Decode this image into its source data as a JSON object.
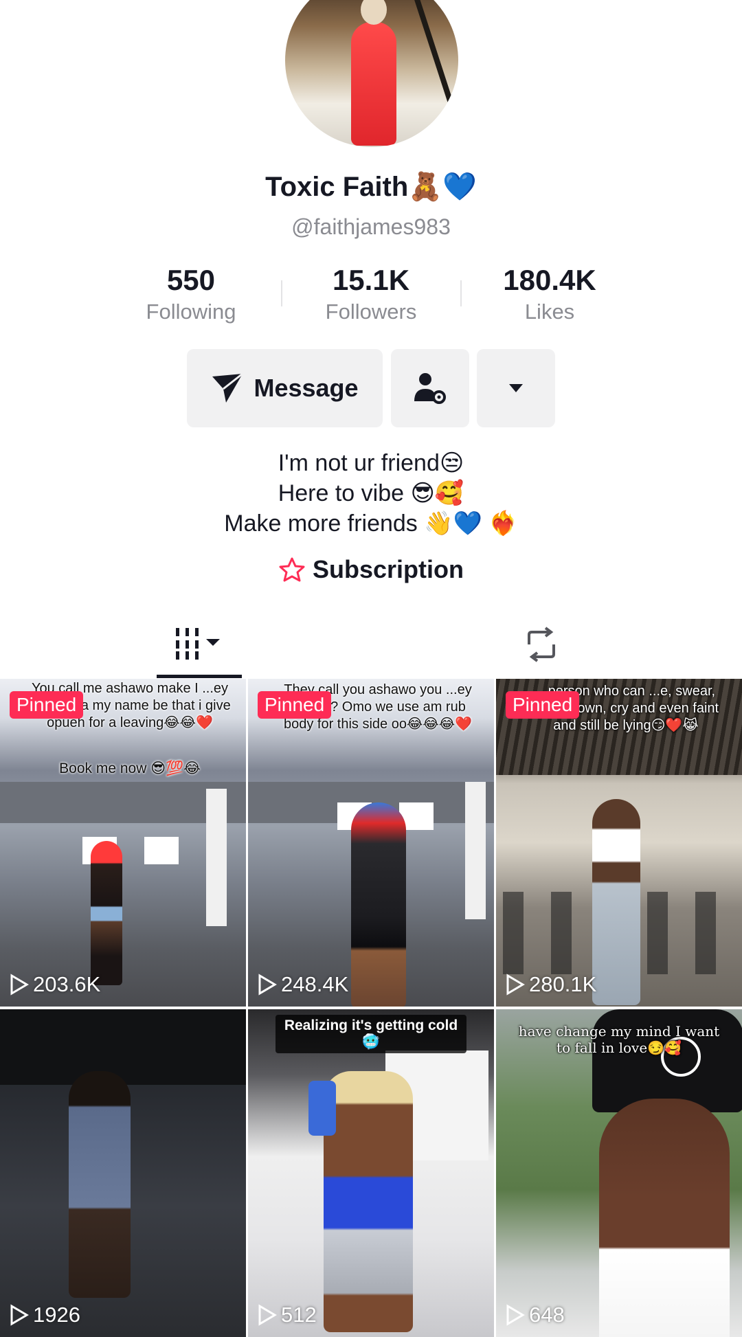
{
  "profile": {
    "display_name": "Toxic Faith🧸💙",
    "handle": "@faithjames983"
  },
  "stats": [
    {
      "value": "550",
      "label": "Following"
    },
    {
      "value": "15.1K",
      "label": "Followers"
    },
    {
      "value": "180.4K",
      "label": "Likes"
    }
  ],
  "actions": {
    "message_label": "Message",
    "icons": [
      "send-icon",
      "person-settings-icon",
      "dropdown-arrow-icon"
    ]
  },
  "bio": {
    "line1": "I'm not ur friend😒",
    "line2": "Here to vibe 😎🥰",
    "line3": "Make more friends 👋💙 ❤️‍🔥"
  },
  "subscription_label": "Subscription",
  "tabs": [
    "grid-icon",
    "repost-icon"
  ],
  "videos": [
    {
      "pinned": "Pinned",
      "caption": "You call me ashawo make I ...ey vex!?? na my name be that i give opueh for a leaving😂😂❤️",
      "caption2": "Book me now 😎💯😂",
      "views": "203.6K"
    },
    {
      "pinned": "Pinned",
      "caption": "They call you ashawo you ...ey vex!??? Omo we use am rub body for this side oo😂😂😂❤️",
      "views": "248.4K"
    },
    {
      "pinned": "Pinned",
      "caption": "...person who can ...e, swear, kneel down, cry and even faint and still be lying😏❤️😹",
      "views": "280.1K"
    },
    {
      "caption": "",
      "views": "1926"
    },
    {
      "caption": "Realizing it's getting cold 🥶",
      "views": "512"
    },
    {
      "caption": "have change my mind I want to fall in love😏🥰",
      "views": "648"
    }
  ],
  "colors": {
    "accent": "#fe2c55",
    "text": "#161823",
    "secondary": "#8a8b91"
  }
}
